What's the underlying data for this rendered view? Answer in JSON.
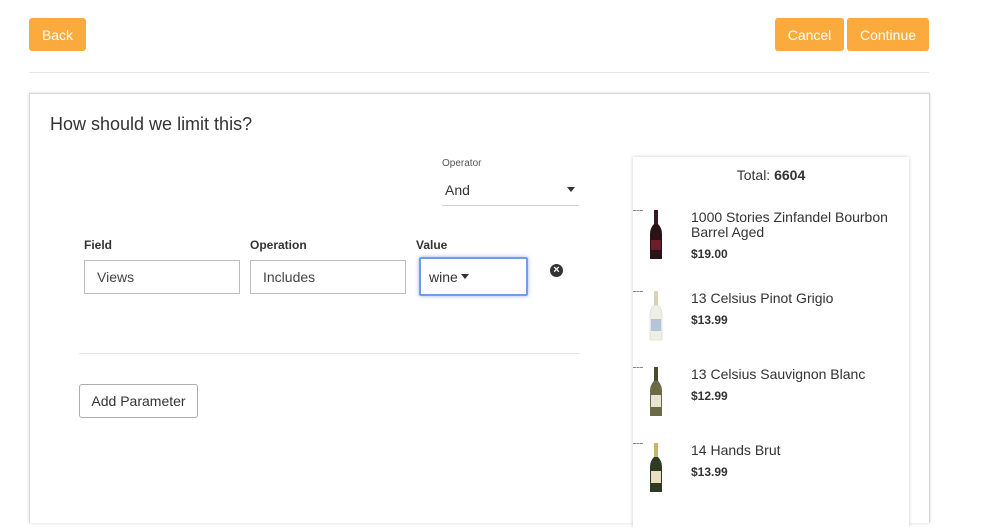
{
  "toolbar": {
    "back_label": "Back",
    "cancel_label": "Cancel",
    "continue_label": "Continue",
    "accent_color": "#fbab3e"
  },
  "panel": {
    "title": "How should we limit this?",
    "operator": {
      "label": "Operator",
      "value": "And"
    },
    "parameter": {
      "field_label": "Field",
      "field_value": "Views",
      "operation_label": "Operation",
      "operation_value": "Includes",
      "value_label": "Value",
      "value_value": "wine"
    },
    "add_parameter_label": "Add Parameter"
  },
  "results": {
    "total_label": "Total:",
    "total_count": "6604",
    "products": [
      {
        "name": "1000 Stories Zinfandel Bourbon Barrel Aged",
        "price": "$19.00",
        "bottle": "red"
      },
      {
        "name": "13 Celsius Pinot Grigio",
        "price": "$13.99",
        "bottle": "clear"
      },
      {
        "name": "13 Celsius Sauvignon Blanc",
        "price": "$12.99",
        "bottle": "green"
      },
      {
        "name": "14 Hands Brut",
        "price": "$13.99",
        "bottle": "dark-green"
      }
    ]
  }
}
